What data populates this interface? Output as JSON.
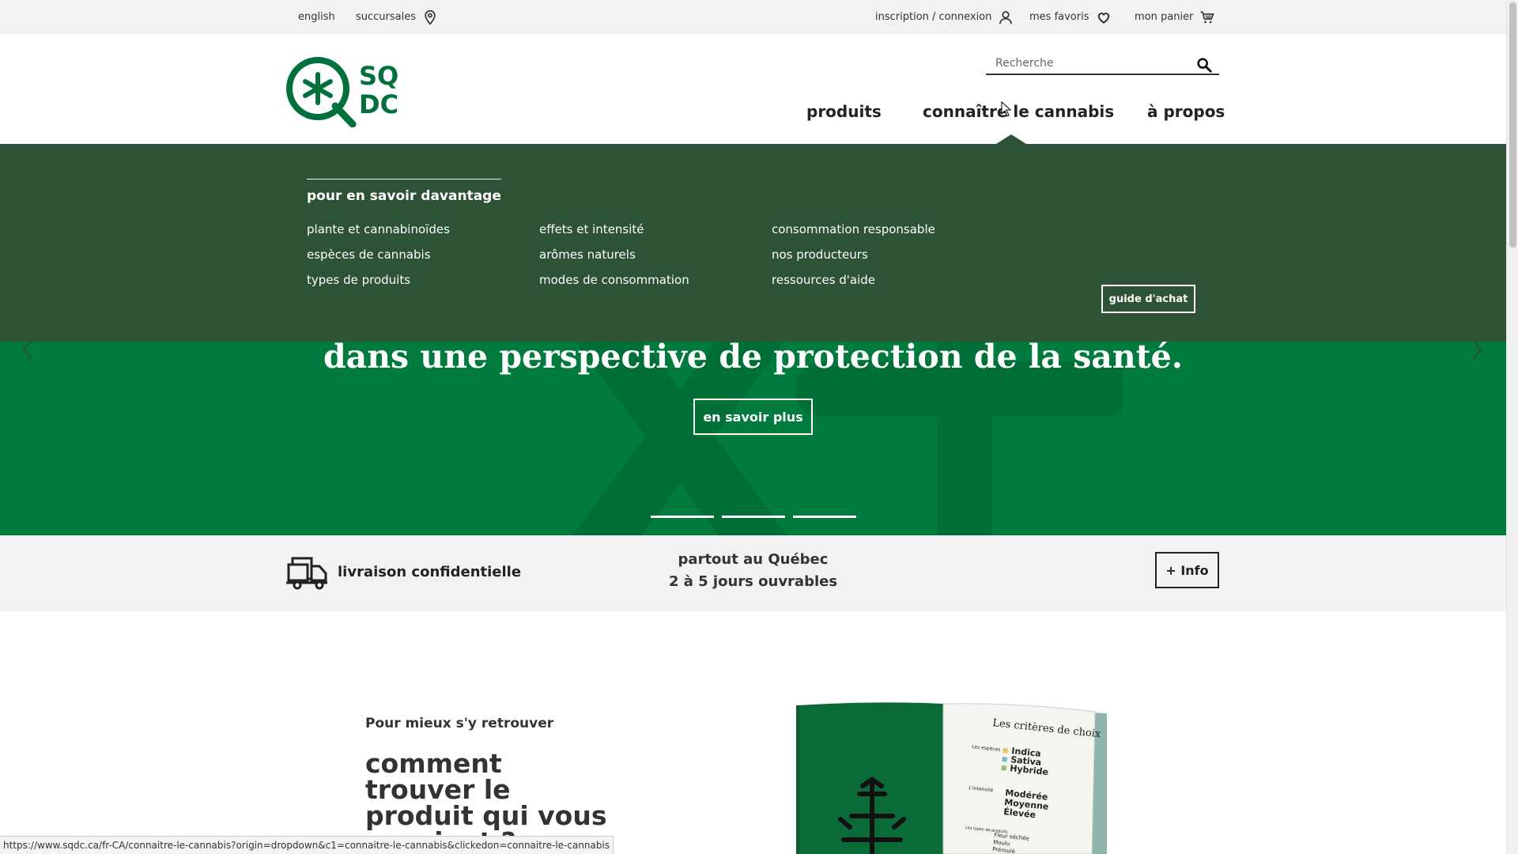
{
  "utility": {
    "language": "english",
    "stores": "succursales",
    "account": "inscription / connexion",
    "favorites": "mes favoris",
    "cart": "mon panier"
  },
  "logo": {
    "line1": "SQ",
    "line2": "DC"
  },
  "search": {
    "placeholder": "Recherche"
  },
  "nav": {
    "products": "produits",
    "learn": "connaître le cannabis",
    "about": "à propos"
  },
  "dropdown": {
    "section_title": "pour en savoir davantage",
    "columns": [
      [
        "plante et cannabinoïdes",
        "espèces de cannabis",
        "types de produits"
      ],
      [
        "effets et intensité",
        "arômes naturels",
        "modes de consommation"
      ],
      [
        "consommation responsable",
        "nos producteurs",
        "ressources d'aide"
      ]
    ],
    "guide_button": "guide d'achat"
  },
  "hero": {
    "title": "dans une perspective de protection de la santé.",
    "button": "en savoir plus"
  },
  "delivery": {
    "label": "livraison confidentielle",
    "line1": "partout au Québec",
    "line2": "2 à 5 jours ouvrables",
    "info_button": "+ Info"
  },
  "content": {
    "eyebrow": "Pour mieux s'y retrouver",
    "headline": "comment trouver le produit qui vous convient ?",
    "book": {
      "title": "Les critères de choix",
      "species_label": "Les espèces",
      "species": [
        "Indica",
        "Sativa",
        "Hybride"
      ],
      "intensity_label": "L'intensité",
      "intensity": [
        "Modérée",
        "Moyenne",
        "Élevée"
      ],
      "types_label": "Les types de produits",
      "types": [
        "Fleur séchée",
        "Moulu",
        "Préroulé"
      ]
    }
  },
  "status_url": "https://www.sqdc.ca/fr-CA/connaitre-le-cannabis?origin=dropdown&c1=connaitre-le-cannabis&clickedon=connaitre-le-cannabis",
  "colors": {
    "brand_green": "#007a3d",
    "dropdown_green": "#2e5236",
    "logo_green": "#00703c"
  }
}
